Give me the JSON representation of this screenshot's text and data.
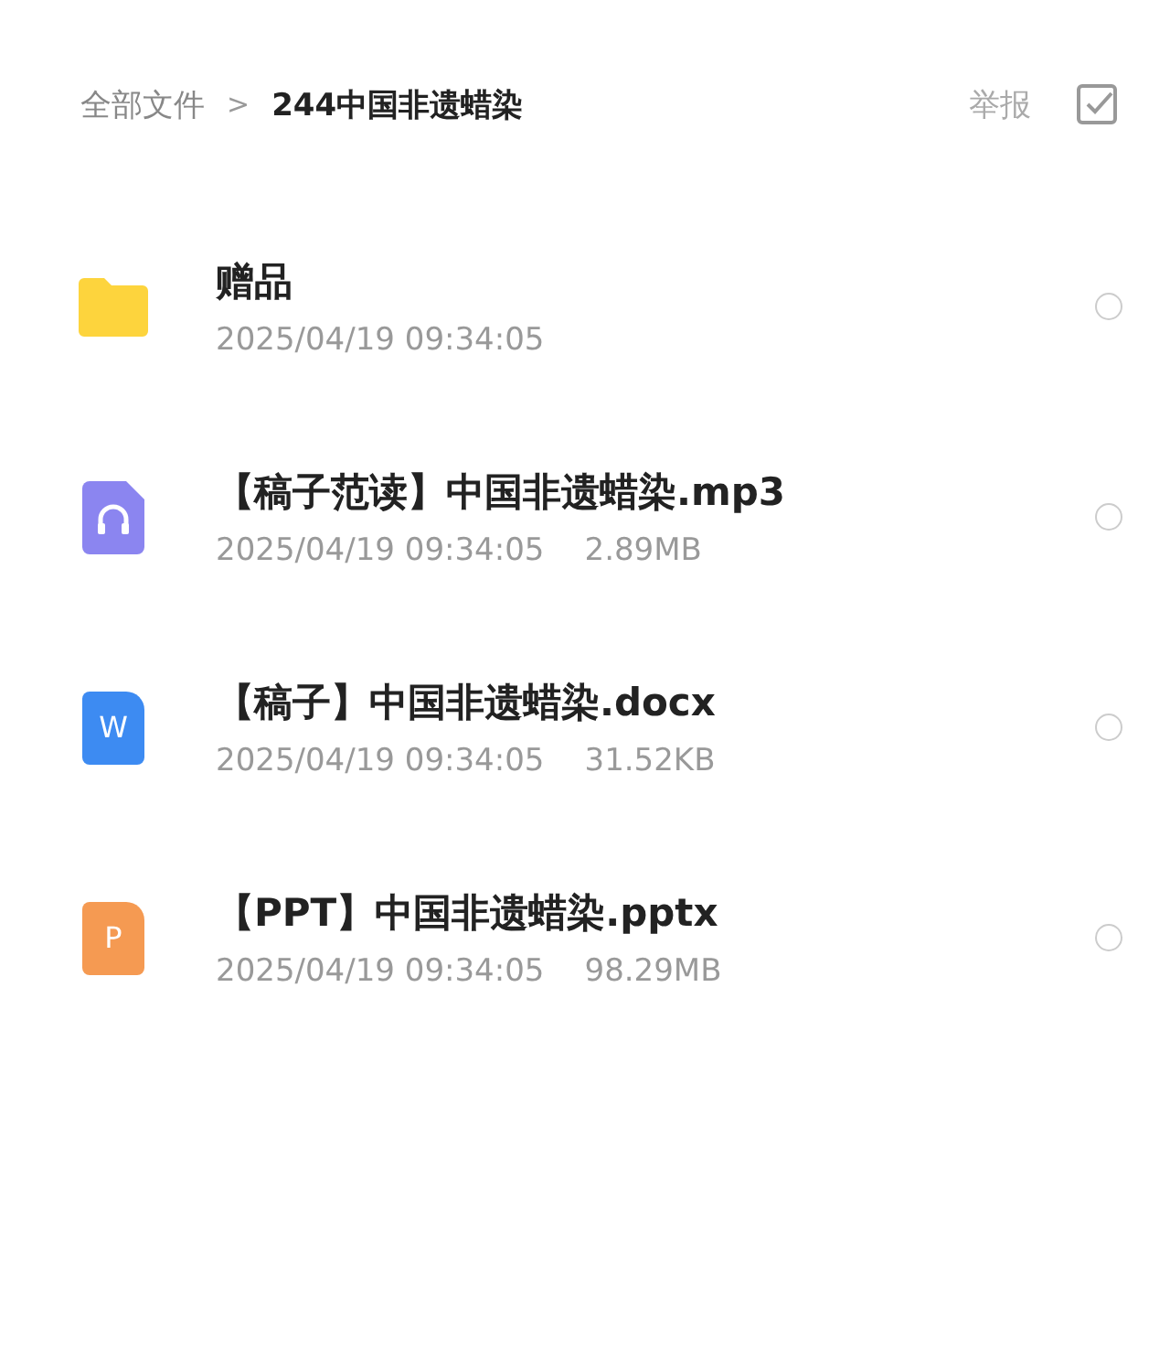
{
  "breadcrumb": {
    "root": "全部文件",
    "separator": ">",
    "current": "244中国非遗蜡染"
  },
  "actions": {
    "report": "举报"
  },
  "files": [
    {
      "kind": "folder",
      "name": "赠品",
      "date": "2025/04/19 09:34:05",
      "selected": false
    },
    {
      "kind": "audio",
      "name": "【稿子范读】中国非遗蜡染.mp3",
      "date": "2025/04/19 09:34:05",
      "size": "2.89MB",
      "selected": false
    },
    {
      "kind": "doc",
      "icon_letter": "W",
      "name": "【稿子】中国非遗蜡染.docx",
      "date": "2025/04/19 09:34:05",
      "size": "31.52KB",
      "selected": false
    },
    {
      "kind": "ppt",
      "icon_letter": "P",
      "name": "【PPT】中国非遗蜡染.pptx",
      "date": "2025/04/19 09:34:05",
      "size": "98.29MB",
      "selected": false
    }
  ]
}
